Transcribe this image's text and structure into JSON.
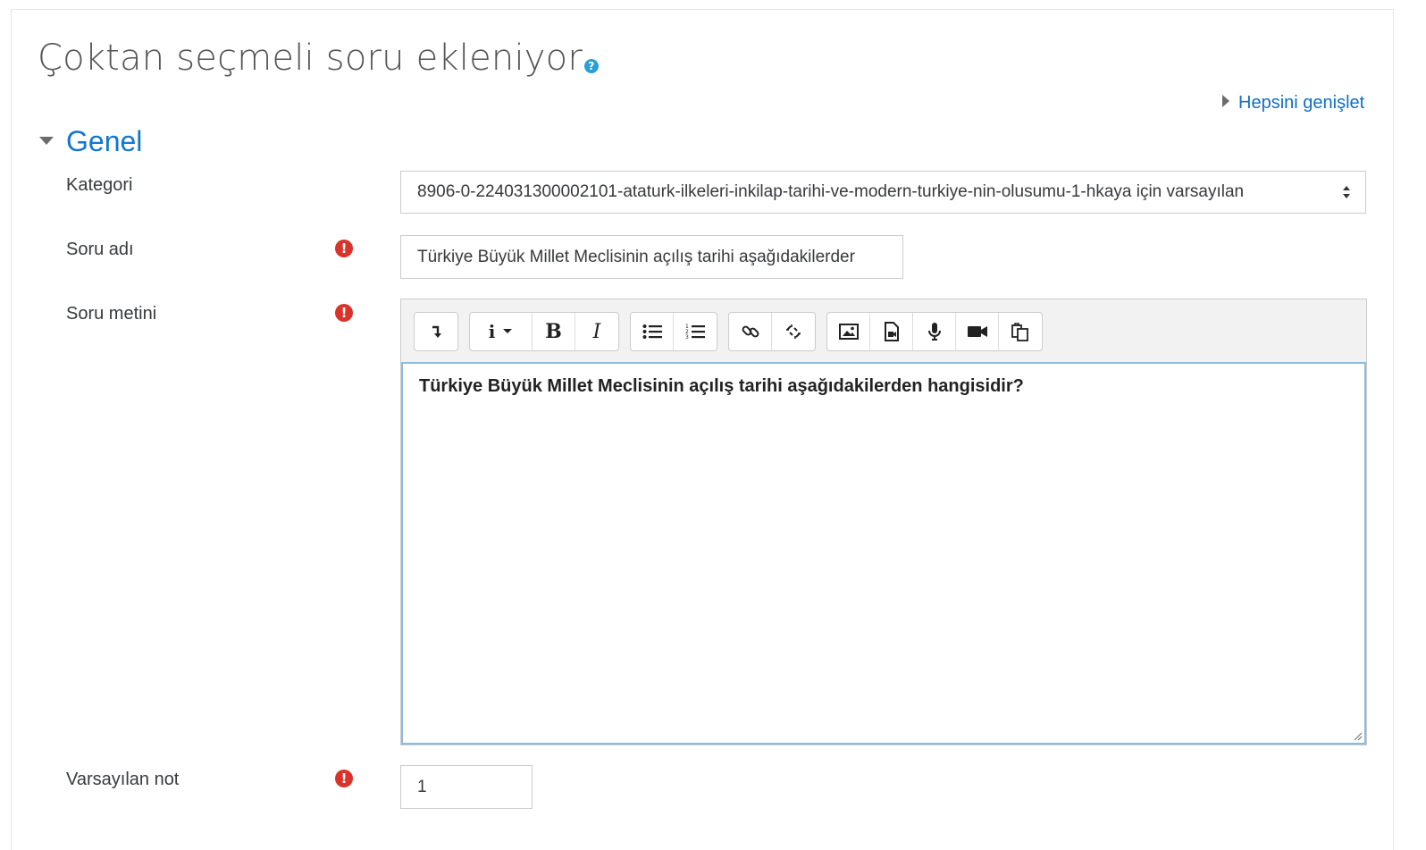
{
  "page": {
    "title": "Çoktan seçmeli soru ekleniyor",
    "help_icon": "question-circle-icon",
    "expand_all_label": "Hepsini genişlet"
  },
  "section": {
    "title": "Genel"
  },
  "fields": {
    "category": {
      "label": "Kategori",
      "value": "8906-0-224031300002101-ataturk-ilkeleri-inkilap-tarihi-ve-modern-turkiye-nin-olusumu-1-hkaya için varsayılan"
    },
    "question_name": {
      "label": "Soru adı",
      "value": "Türkiye Büyük Millet Meclisinin açılış tarihi aşağıdakilerder",
      "required_icon": "exclamation-circle-icon"
    },
    "question_text": {
      "label": "Soru metini",
      "value": "Türkiye Büyük Millet Meclisinin açılış tarihi aşağıdakilerden hangisidir?",
      "required_icon": "exclamation-circle-icon"
    },
    "default_mark": {
      "label": "Varsayılan not",
      "value": "1",
      "required_icon": "exclamation-circle-icon"
    }
  },
  "editor_toolbar": {
    "buttons": [
      "collapse-toolbar-icon",
      "paragraph-style-icon",
      "bold-icon",
      "italic-icon",
      "unordered-list-icon",
      "ordered-list-icon",
      "link-icon",
      "unlink-icon",
      "image-icon",
      "media-icon",
      "record-audio-icon",
      "record-video-icon",
      "manage-files-icon"
    ]
  },
  "colors": {
    "link": "#0f6fc5",
    "section_heading": "#1177d1",
    "required": "#d9342b",
    "help": "#2a9fd6",
    "focus_border": "#8bbcdf"
  }
}
